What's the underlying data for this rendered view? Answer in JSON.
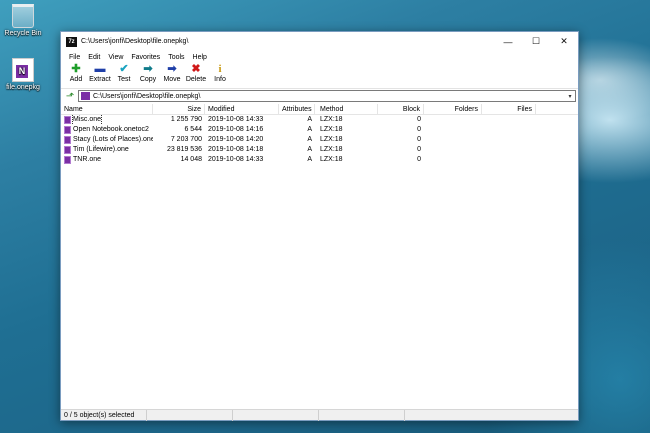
{
  "desktop": {
    "icons": [
      {
        "label": "Recycle Bin",
        "icon": "recycle-bin-icon"
      },
      {
        "label": "file.onepkg",
        "icon": "onenote-package-icon"
      }
    ]
  },
  "window": {
    "title": "C:\\Users\\jonfi\\Desktop\\file.onepkg\\",
    "app_icon_text": "7z",
    "controls": {
      "minimize": "—",
      "maximize": "☐",
      "close": "✕"
    }
  },
  "menu": [
    "File",
    "Edit",
    "View",
    "Favorites",
    "Tools",
    "Help"
  ],
  "toolbar": [
    {
      "label": "Add",
      "glyph": "✚",
      "color": "#1e9e2a"
    },
    {
      "label": "Extract",
      "glyph": "▬",
      "color": "#1f3fa8"
    },
    {
      "label": "Test",
      "glyph": "✔",
      "color": "#1aa3c0"
    },
    {
      "label": "Copy",
      "glyph": "➡",
      "color": "#0f7b8a"
    },
    {
      "label": "Move",
      "glyph": "➡",
      "color": "#1f3fa8"
    },
    {
      "label": "Delete",
      "glyph": "✖",
      "color": "#d01818"
    },
    {
      "label": "Info",
      "glyph": "i",
      "color": "#c99a12"
    }
  ],
  "address": {
    "path": "C:\\Users\\jonfi\\Desktop\\file.onepkg\\"
  },
  "columns": {
    "name": "Name",
    "size": "Size",
    "modified": "Modified",
    "attributes": "Attributes",
    "method": "Method",
    "block": "Block",
    "folders": "Folders",
    "files": "Files"
  },
  "files": [
    {
      "name": "Misc.one",
      "size": "1 255 790",
      "modified": "2019-10-08 14:33",
      "attributes": "A",
      "method": "LZX:18",
      "block": "0"
    },
    {
      "name": "Open Notebook.onetoc2",
      "size": "6 544",
      "modified": "2019-10-08 14:16",
      "attributes": "A",
      "method": "LZX:18",
      "block": "0"
    },
    {
      "name": "Stacy (Lots of Places).one",
      "size": "7 203 700",
      "modified": "2019-10-08 14:20",
      "attributes": "A",
      "method": "LZX:18",
      "block": "0"
    },
    {
      "name": "Tim (Lifewire).one",
      "size": "23 819 536",
      "modified": "2019-10-08 14:18",
      "attributes": "A",
      "method": "LZX:18",
      "block": "0"
    },
    {
      "name": "TNR.one",
      "size": "14 048",
      "modified": "2019-10-08 14:33",
      "attributes": "A",
      "method": "LZX:18",
      "block": "0"
    }
  ],
  "status": {
    "selection": "0 / 5 object(s) selected"
  },
  "colors": {
    "onenote_purple": "#7b2fa5",
    "window_border": "#7a9cc0"
  }
}
